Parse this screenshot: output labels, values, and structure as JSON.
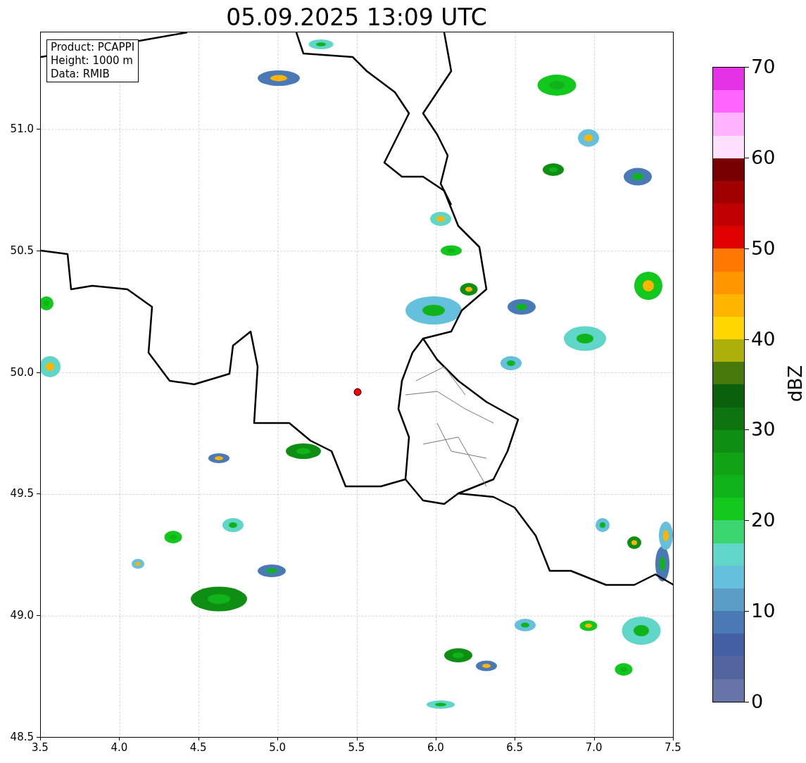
{
  "title": "05.09.2025 13:09 UTC",
  "info_box": [
    "Product: PCAPPI",
    "Height: 1000 m",
    "Data: RMIB"
  ],
  "x_ticks": [
    "3.5",
    "4.0",
    "4.5",
    "5.0",
    "5.5",
    "6.0",
    "6.5",
    "7.0",
    "7.5"
  ],
  "y_ticks": [
    "51.0",
    "50.5",
    "50.0",
    "49.5",
    "49.0",
    "48.5"
  ],
  "colorbar": {
    "label": "dBZ",
    "ticks": [
      "70",
      "60",
      "50",
      "40",
      "30",
      "20",
      "10",
      "0"
    ],
    "bins": [
      {
        "color": "#e632e6"
      },
      {
        "color": "#ff64ff"
      },
      {
        "color": "#ffb4ff"
      },
      {
        "color": "#ffe0ff"
      },
      {
        "color": "#780000"
      },
      {
        "color": "#a00000"
      },
      {
        "color": "#c00000"
      },
      {
        "color": "#e00000"
      },
      {
        "color": "#ff7800"
      },
      {
        "color": "#ff9600"
      },
      {
        "color": "#ffb400"
      },
      {
        "color": "#ffd700"
      },
      {
        "color": "#aeb00a"
      },
      {
        "color": "#477a0a"
      },
      {
        "color": "#0a600c"
      },
      {
        "color": "#0c7510"
      },
      {
        "color": "#0e8e12"
      },
      {
        "color": "#10a314"
      },
      {
        "color": "#10b41a"
      },
      {
        "color": "#12c81c"
      },
      {
        "color": "#3cd671"
      },
      {
        "color": "#5fd6c8"
      },
      {
        "color": "#64c0dd"
      },
      {
        "color": "#5a9dc7"
      },
      {
        "color": "#4a7ab5"
      },
      {
        "color": "#4260a3"
      },
      {
        "color": "#52659e"
      },
      {
        "color": "#6674a8"
      }
    ]
  }
}
